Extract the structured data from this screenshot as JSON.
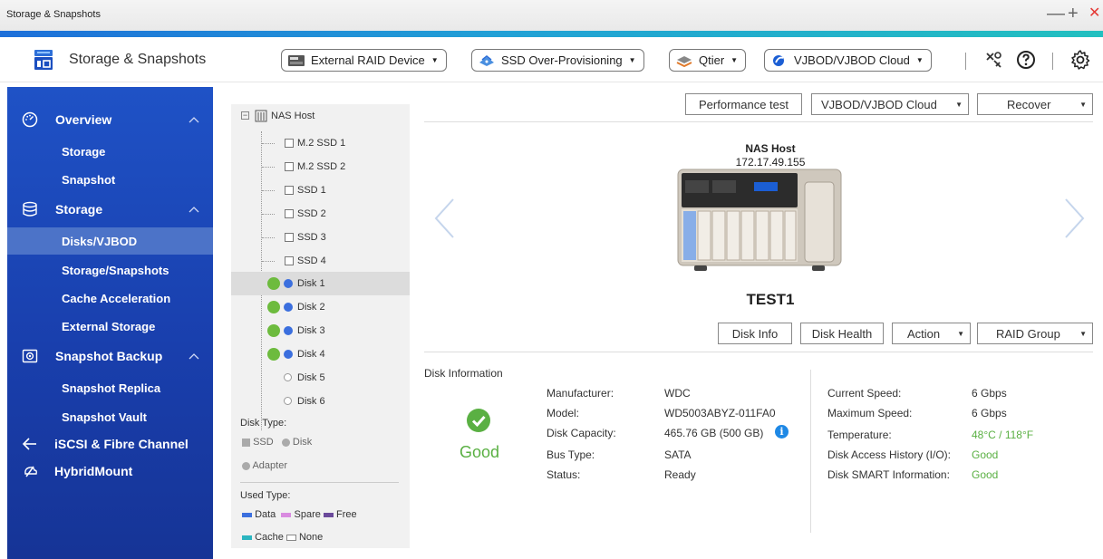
{
  "window": {
    "title": "Storage & Snapshots",
    "controls": [
      "—",
      "+",
      "✕"
    ]
  },
  "header": {
    "app_name": "Storage & Snapshots",
    "buttons": [
      {
        "label": "External RAID Device",
        "icon": "external-raid-icon"
      },
      {
        "label": "SSD Over-Provisioning",
        "icon": "ssd-overprovisioning-icon"
      },
      {
        "label": "Qtier",
        "icon": "qtier-icon"
      },
      {
        "label": "VJBOD/VJBOD Cloud",
        "icon": "vjbod-cloud-icon"
      }
    ],
    "icons": [
      "tools-icon",
      "help-icon",
      "settings-icon"
    ]
  },
  "sidebar": {
    "groups": [
      {
        "label": "Overview",
        "icon": "overview-icon",
        "items": [
          "Storage",
          "Snapshot"
        ]
      },
      {
        "label": "Storage",
        "icon": "storage-icon",
        "items": [
          "Disks/VJBOD",
          "Storage/Snapshots",
          "Cache Acceleration",
          "External Storage"
        ]
      },
      {
        "label": "Snapshot Backup",
        "icon": "snapshot-backup-icon",
        "items": [
          "Snapshot Replica",
          "Snapshot Vault"
        ]
      },
      {
        "label": "iSCSI & Fibre Channel",
        "icon": "iscsi-icon",
        "items": []
      },
      {
        "label": "HybridMount",
        "icon": "hybridmount-icon",
        "items": []
      }
    ],
    "active_item": "Disks/VJBOD"
  },
  "tree": {
    "root": "NAS Host",
    "nodes": [
      {
        "label": "M.2 SSD 1",
        "kind": "checkbox"
      },
      {
        "label": "M.2 SSD 2",
        "kind": "checkbox"
      },
      {
        "label": "SSD 1",
        "kind": "checkbox"
      },
      {
        "label": "SSD 2",
        "kind": "checkbox"
      },
      {
        "label": "SSD 3",
        "kind": "checkbox"
      },
      {
        "label": "SSD 4",
        "kind": "checkbox"
      },
      {
        "label": "Disk 1",
        "kind": "disk-data",
        "selected": true
      },
      {
        "label": "Disk 2",
        "kind": "disk-data"
      },
      {
        "label": "Disk 3",
        "kind": "disk-data"
      },
      {
        "label": "Disk 4",
        "kind": "disk-data"
      },
      {
        "label": "Disk 5",
        "kind": "disk-empty"
      },
      {
        "label": "Disk 6",
        "kind": "disk-empty"
      }
    ],
    "disk_type_label": "Disk Type:",
    "disk_types": [
      "SSD",
      "Disk",
      "Adapter"
    ],
    "used_type_label": "Used Type:",
    "used_types": [
      {
        "label": "Data",
        "color": "#3b6fde"
      },
      {
        "label": "Spare",
        "color": "#d98be0"
      },
      {
        "label": "Free",
        "color": "#6b4a9b"
      },
      {
        "label": "Cache",
        "color": "#2bb5c0"
      },
      {
        "label": "None",
        "color": "#ffffff"
      }
    ]
  },
  "main": {
    "top_buttons": {
      "perf": "Performance test",
      "vjbod": "VJBOD/VJBOD Cloud",
      "recover": "Recover"
    },
    "nas": {
      "title": "NAS Host",
      "ip": "172.17.49.155"
    },
    "device_name": "TEST1",
    "mid_buttons": {
      "disk_info": "Disk Info",
      "disk_health": "Disk Health",
      "action": "Action",
      "raid_group": "RAID Group"
    },
    "disk_info": {
      "section_title": "Disk Information",
      "health": "Good",
      "left_fields": [
        {
          "label": "Manufacturer:",
          "value": "WDC"
        },
        {
          "label": "Model:",
          "value": "WD5003ABYZ-011FA0"
        },
        {
          "label": "Disk Capacity:",
          "value": "465.76 GB (500 GB)"
        },
        {
          "label": "Bus Type:",
          "value": "SATA"
        },
        {
          "label": "Status:",
          "value": "Ready"
        }
      ],
      "right_fields": [
        {
          "label": "Current Speed:",
          "value": "6 Gbps",
          "good": false
        },
        {
          "label": "Maximum Speed:",
          "value": "6 Gbps",
          "good": false
        },
        {
          "label": "Temperature:",
          "value": "48°C / 118°F",
          "good": true
        },
        {
          "label": "Disk Access History (I/O):",
          "value": "Good",
          "good": true
        },
        {
          "label": "Disk SMART Information:",
          "value": "Good",
          "good": true
        }
      ]
    }
  },
  "colors": {
    "accent": "#1f52c6",
    "good": "#5ab043",
    "info": "#1e88e5",
    "close": "#e53935"
  }
}
